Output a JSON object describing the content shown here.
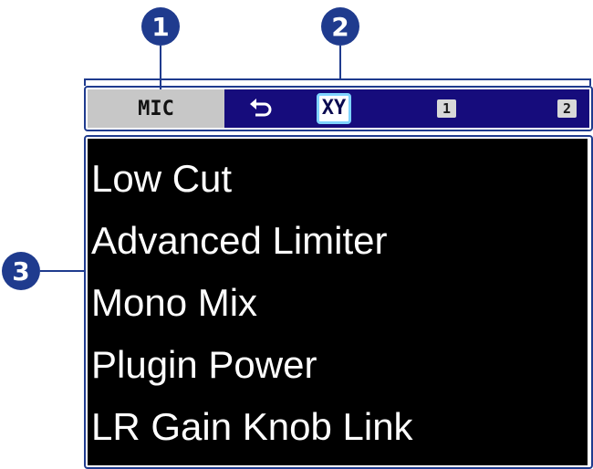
{
  "callouts": [
    "1",
    "2",
    "3"
  ],
  "tabs": {
    "mic_label": "MIC",
    "back_glyph": "⮌",
    "xy_label": "XY",
    "input1_label": "1",
    "input2_label": "2"
  },
  "menu": {
    "items": [
      {
        "label": "Low Cut"
      },
      {
        "label": "Advanced Limiter"
      },
      {
        "label": "Mono Mix"
      },
      {
        "label": "Plugin Power"
      },
      {
        "label": "LR Gain Knob Link"
      }
    ]
  },
  "colors": {
    "callout": "#1f3b8e",
    "tabbar_bg": "#160c7c",
    "selected_tab_bg": "#c7c7c7",
    "menu_bg": "#000000",
    "menu_text": "#ffffff"
  }
}
